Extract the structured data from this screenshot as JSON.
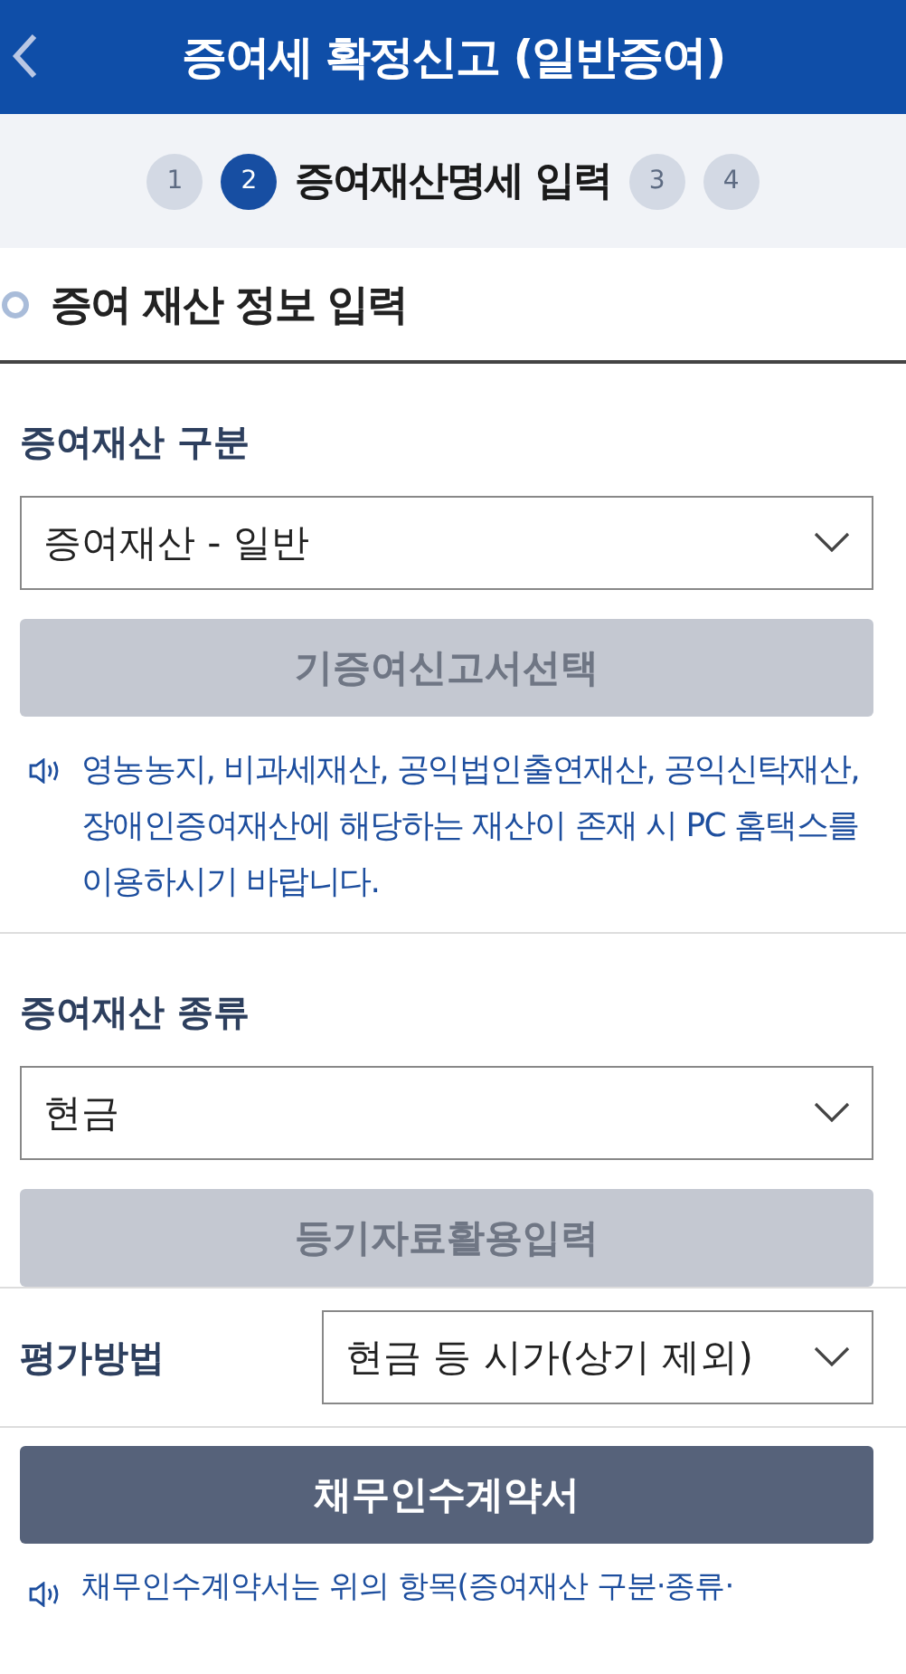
{
  "header": {
    "title": "증여세 확정신고 (일반증여)"
  },
  "steps": [
    {
      "number": "1",
      "selected": false
    },
    {
      "number": "2",
      "selected": true,
      "label": "증여재산명세 입력"
    },
    {
      "number": "3",
      "selected": false
    },
    {
      "number": "4",
      "selected": false
    }
  ],
  "section_title": "증여 재산 정보 입력",
  "blocks": [
    {
      "kind": "stacked",
      "label": "증여재산 구분",
      "value": "증여재산 - 일반",
      "button": {
        "label": "기증여신고서선택",
        "disabled": true
      },
      "notice": "영농농지, 비과세재산, 공익법인출연재산, 공익신탁재산, 장애인증여재산에 해당하는 재산이 존재 시 PC 홈택스를 이용하시기 바랍니다."
    },
    {
      "kind": "stacked",
      "label": "증여재산 종류",
      "value": "현금",
      "button": {
        "label": "등기자료활용입력",
        "disabled": true
      }
    },
    {
      "kind": "inline",
      "label": "평가방법",
      "value": "현금 등 시가(상기 제외)"
    },
    {
      "kind": "action",
      "button": {
        "label": "채무인수계약서",
        "disabled": false
      },
      "notice": "채무인수계약서는 위의 항목(증여재산 구분·종류·"
    }
  ]
}
